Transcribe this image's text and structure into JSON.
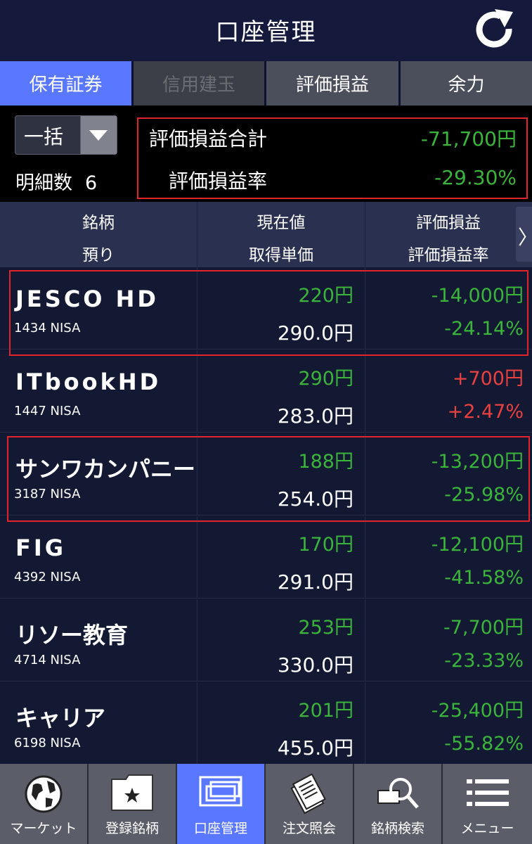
{
  "header": {
    "title": "口座管理"
  },
  "tabs": [
    {
      "label": "保有証券"
    },
    {
      "label": "信用建玉"
    },
    {
      "label": "評価損益"
    },
    {
      "label": "余力"
    }
  ],
  "summary": {
    "bulk_select": "一括",
    "count_label": "明細数",
    "count_value": "6",
    "total_pl_label": "評価損益合計",
    "total_pl_value": "-71,700円",
    "pl_rate_label": "評価損益率",
    "pl_rate_value": "-29.30%"
  },
  "columns": {
    "c1_top": "銘柄",
    "c1_bottom": "預り",
    "c2_top": "現在値",
    "c2_bottom": "取得単価",
    "c3_top": "評価損益",
    "c3_bottom": "評価損益率",
    "more": "〉"
  },
  "holdings": [
    {
      "name": "JESCO HD",
      "code": "1434 NISA",
      "price": "220円",
      "cost": "290.0円",
      "pl": "-14,000円",
      "rate": "-24.14%"
    },
    {
      "name": "ITbookHD",
      "code": "1447 NISA",
      "price": "290円",
      "cost": "283.0円",
      "pl": "+700円",
      "rate": "+2.47%"
    },
    {
      "name": "サンワカンパニー",
      "code": "3187 NISA",
      "price": "188円",
      "cost": "254.0円",
      "pl": "-13,200円",
      "rate": "-25.98%"
    },
    {
      "name": "FIG",
      "code": "4392 NISA",
      "price": "170円",
      "cost": "291.0円",
      "pl": "-12,100円",
      "rate": "-41.58%"
    },
    {
      "name": "リソー教育",
      "code": "4714 NISA",
      "price": "253円",
      "cost": "330.0円",
      "pl": "-7,700円",
      "rate": "-23.33%"
    },
    {
      "name": "キャリア",
      "code": "6198 NISA",
      "price": "201円",
      "cost": "455.0円",
      "pl": "-25,400円",
      "rate": "-55.82%"
    }
  ],
  "nav": [
    {
      "label": "マーケット",
      "icon": "globe-icon"
    },
    {
      "label": "登録銘柄",
      "icon": "star-folder-icon"
    },
    {
      "label": "口座管理",
      "icon": "account-icon"
    },
    {
      "label": "注文照会",
      "icon": "documents-icon"
    },
    {
      "label": "銘柄検索",
      "icon": "search-icon"
    },
    {
      "label": "メニュー",
      "icon": "menu-icon"
    }
  ],
  "colors": {
    "accent": "#5a78ff",
    "loss": "#3bb43b",
    "gain": "#e94040",
    "highlight": "#e0242a"
  }
}
